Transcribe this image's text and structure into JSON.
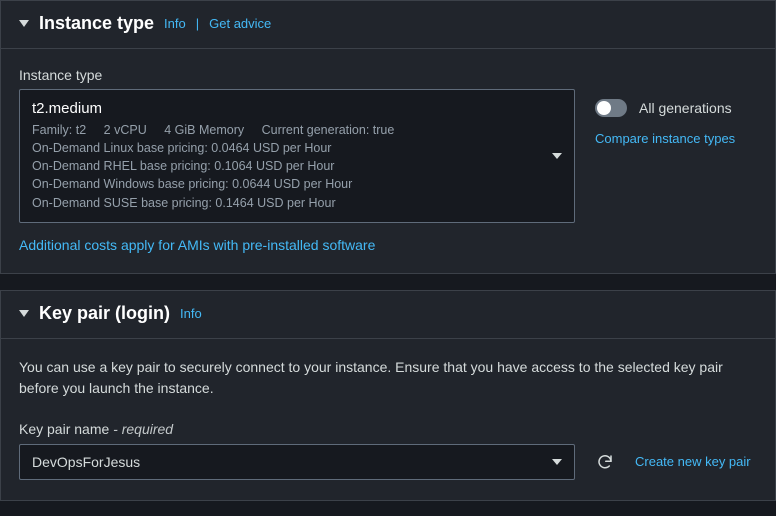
{
  "instance_type_section": {
    "title": "Instance type",
    "info_link": "Info",
    "advice_link": "Get advice",
    "field_label": "Instance type",
    "selector": {
      "name": "t2.medium",
      "details_line": {
        "family": "Family: t2",
        "vcpu": "2 vCPU",
        "memory": "4 GiB Memory",
        "current_gen": "Current generation: true"
      },
      "pricing": [
        "On-Demand Linux base pricing: 0.0464 USD per Hour",
        "On-Demand RHEL base pricing: 0.1064 USD per Hour",
        "On-Demand Windows base pricing: 0.0644 USD per Hour",
        "On-Demand SUSE base pricing: 0.1464 USD per Hour"
      ]
    },
    "all_generations_label": "All generations",
    "compare_link": "Compare instance types",
    "additional_costs": "Additional costs apply for AMIs with pre-installed software"
  },
  "key_pair_section": {
    "title": "Key pair (login)",
    "info_link": "Info",
    "description": "You can use a key pair to securely connect to your instance. Ensure that you have access to the selected key pair before you launch the instance.",
    "field_label": "Key pair name",
    "required": " - required",
    "selected_value": "DevOpsForJesus",
    "create_link": "Create new key pair"
  }
}
